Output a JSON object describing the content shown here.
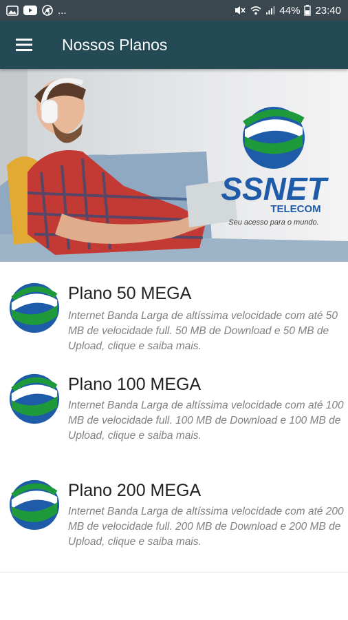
{
  "status_bar": {
    "left_more": "...",
    "battery": "44%",
    "time": "23:40"
  },
  "app_bar": {
    "title": "Nossos Planos",
    "menu_icon": "hamburger-menu-icon"
  },
  "banner": {
    "brand": "SSNET",
    "brand_sub": "TELECOM",
    "tagline": "Seu acesso para o mundo."
  },
  "plans": [
    {
      "title": "Plano 50 MEGA",
      "description": "Internet Banda Larga de altíssima velocidade com até 50 MB de velocidade full. 50 MB de Download e 50 MB de Upload, clique e saiba mais."
    },
    {
      "title": "Plano 100 MEGA",
      "description": "Internet Banda Larga de altíssima velocidade com até 100 MB de velocidade full. 100 MB de Download e 100 MB de Upload, clique e saiba mais."
    },
    {
      "title": "Plano 200 MEGA",
      "description": "Internet Banda Larga de altíssima velocidade com até 200 MB de velocidade full. 200 MB de Download e 200 MB de Upload, clique e saiba mais."
    }
  ],
  "colors": {
    "status_bar": "#3a474e",
    "app_bar": "#234a55",
    "logo_blue": "#1e5ba8",
    "logo_green": "#1e9a3a"
  }
}
